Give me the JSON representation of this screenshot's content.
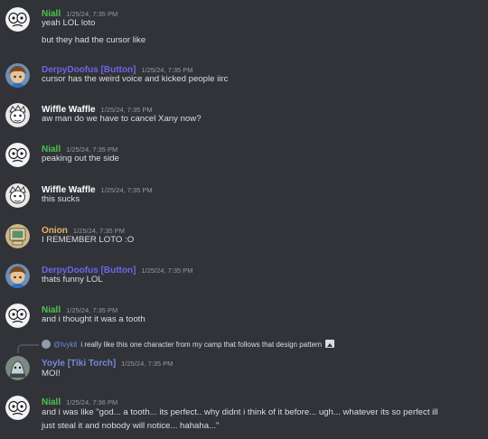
{
  "colors": {
    "background": "#313338",
    "text": "#dbdee1",
    "timestamp": "#949ba4",
    "niall": "#4ec253",
    "derpy": "#6b67e8",
    "wiffle": "#ffffff",
    "onion": "#e8b463",
    "yoyle": "#7289da"
  },
  "messages": [
    {
      "author": "Niall",
      "time": "1/25/24, 7:35 PM",
      "lines": [
        "yeah LOL loto",
        "but they had the cursor like"
      ],
      "avatar": "wide-eyed-face-avatar"
    },
    {
      "author": "DerpyDoofus [Button]",
      "time": "1/25/24, 7:35 PM",
      "lines": [
        "cursor has the weird voice and kicked people iirc"
      ],
      "avatar": "brown-hair-character-avatar"
    },
    {
      "author": "Wiffle Waffle",
      "time": "1/25/24, 7:35 PM",
      "lines": [
        "aw man do we have to cancel Xany now?"
      ],
      "avatar": "sketch-character-avatar"
    },
    {
      "author": "Niall",
      "time": "1/25/24, 7:35 PM",
      "lines": [
        "peaking out the side"
      ],
      "avatar": "wide-eyed-face-avatar"
    },
    {
      "author": "Wiffle Waffle",
      "time": "1/25/24, 7:35 PM",
      "lines": [
        "this sucks"
      ],
      "avatar": "sketch-character-avatar"
    },
    {
      "author": "Onion",
      "time": "1/25/24, 7:35 PM",
      "lines": [
        "I REMEMBER LOTO :O"
      ],
      "avatar": "old-computer-avatar"
    },
    {
      "author": "DerpyDoofus [Button]",
      "time": "1/25/24, 7:35 PM",
      "lines": [
        "thats funny LOL"
      ],
      "avatar": "brown-hair-character-avatar"
    },
    {
      "author": "Niall",
      "time": "1/25/24, 7:35 PM",
      "lines": [
        "and i thought it was a tooth"
      ],
      "avatar": "wide-eyed-face-avatar"
    },
    {
      "author": "Yoyle [Tiki Torch]",
      "time": "1/25/24, 7:35 PM",
      "lines": [
        "MOI!"
      ],
      "avatar": "yoyle-character-avatar",
      "reply": {
        "name": "@Ivykit",
        "text": "i really like this one character from my camp that follows that design pattern"
      }
    },
    {
      "author": "Niall",
      "time": "1/25/24, 7:36 PM",
      "lines": [
        "and i was like \"god... a tooth... its perfect.. why didnt i think of it before... ugh... whatever its so perfect ill",
        "just steal it and nobody will notice... hahaha...\""
      ],
      "avatar": "wide-eyed-face-avatar"
    }
  ]
}
